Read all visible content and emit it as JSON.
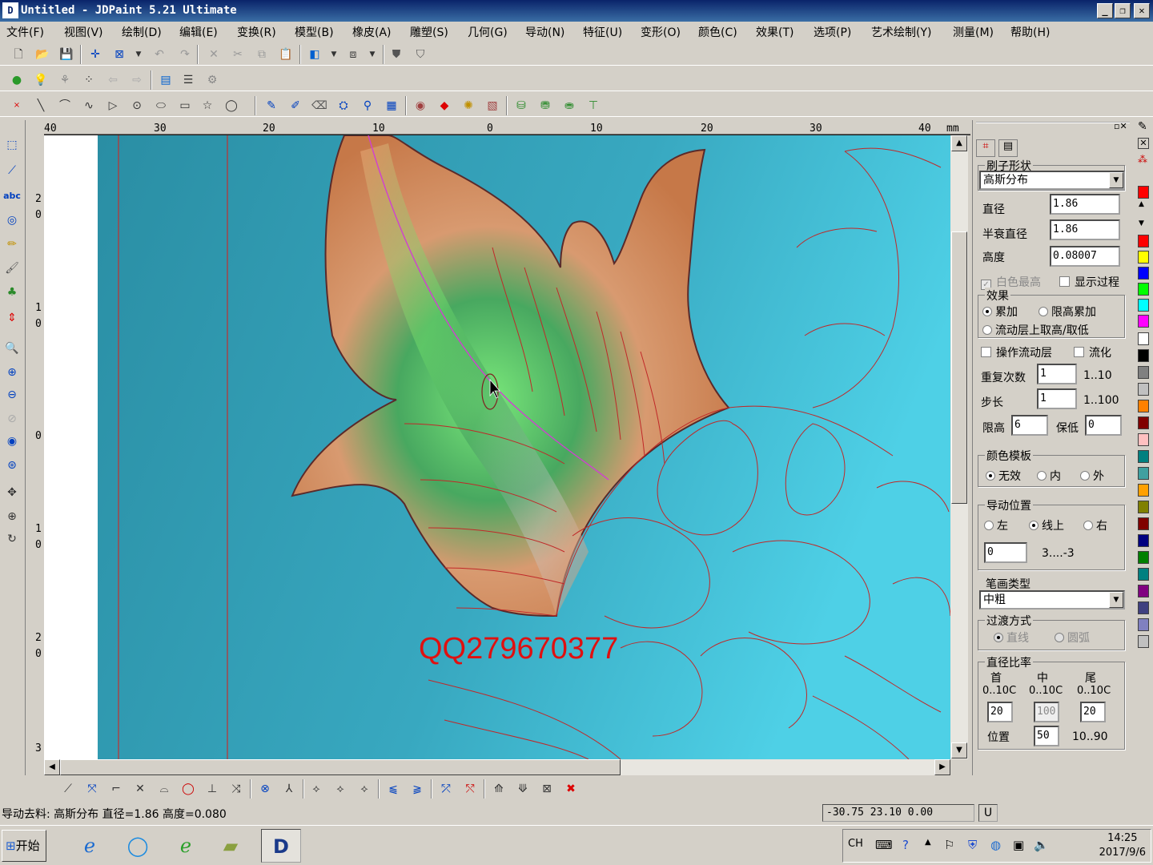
{
  "window": {
    "logo": "D",
    "title": "Untitled - JDPaint 5.21 Ultimate",
    "minimize": "_",
    "restore": "❐",
    "close": "✕"
  },
  "menu": [
    "文件(F)",
    "视图(V)",
    "绘制(D)",
    "编辑(E)",
    "变换(R)",
    "模型(B)",
    "橡皮(A)",
    "雕塑(S)",
    "几何(G)",
    "导动(N)",
    "特征(U)",
    "变形(O)",
    "颜色(C)",
    "效果(T)",
    "选项(P)",
    "艺术绘制(Y)",
    "测量(M)",
    "帮助(H)"
  ],
  "ruler_top": [
    "40",
    "30",
    "20",
    "10",
    "0",
    "10",
    "20",
    "30",
    "40",
    "mm"
  ],
  "ruler_left": [
    "2",
    "0",
    "1",
    "0",
    "0",
    "1",
    "0",
    "2",
    "0",
    "3",
    "0"
  ],
  "canvas": {
    "watermark": "QQ279670377",
    "bg_color": "#3aaec4",
    "relief_color": "#d98a5a"
  },
  "panel": {
    "brush_shape_title": "刷子形状",
    "brush_shape_value": "高斯分布",
    "diameter_label": "直径",
    "diameter_value": "1.86",
    "half_diameter_label": "半衰直径",
    "half_diameter_value": "1.86",
    "height_label": "高度",
    "height_value": "0.08007",
    "white_highest_label": "白色最高",
    "show_process_label": "显示过程",
    "effect_title": "效果",
    "effect_accumulate": "累加",
    "effect_limit_accumulate": "限高累加",
    "effect_flow_layer": "流动层上取高/取低",
    "operate_flow_label": "操作流动层",
    "streamline_label": "流化",
    "repeat_label": "重复次数",
    "repeat_value": "1",
    "repeat_range": "1..10",
    "step_label": "步长",
    "step_value": "1",
    "step_range": "1..100",
    "limit_high_label": "限高",
    "limit_high_value": "6",
    "keep_low_label": "保低",
    "keep_low_value": "0",
    "color_template_title": "颜色模板",
    "ct_none": "无效",
    "ct_inner": "内",
    "ct_outer": "外",
    "guide_pos_title": "导动位置",
    "gp_left": "左",
    "gp_online": "线上",
    "gp_right": "右",
    "gp_value": "0",
    "gp_range": "3....-3",
    "stroke_type_title": "笔画类型",
    "stroke_type_value": "中粗",
    "transition_title": "过渡方式",
    "tr_line": "直线",
    "tr_arc": "圆弧",
    "ratio_title": "直径比率",
    "ratio_head": "首",
    "ratio_mid": "中",
    "ratio_tail": "尾",
    "ratio_range": "0..10C",
    "ratio_head_value": "20",
    "ratio_mid_value": "100",
    "ratio_tail_value": "20",
    "position_label": "位置",
    "position_value": "50",
    "position_range": "10..90"
  },
  "palette": [
    "#ff0000",
    "#ff0000",
    "#ffff00",
    "#0000ff",
    "#00ff00",
    "#00ffff",
    "#ff00ff",
    "#ffffff",
    "#000000",
    "#808080",
    "#c0c0c0",
    "#ff8000",
    "#800000",
    "#ffc0c0",
    "#008080",
    "#40a0a0",
    "#ffa000",
    "#808000",
    "#800000",
    "#000080",
    "#008000",
    "#008080",
    "#800080",
    "#404080",
    "#8080c0",
    "#c0c0c0"
  ],
  "status": {
    "left": "导动去料: 高斯分布  直径=1.86  高度=0.080",
    "coords": "-30.75 23.10 0.00",
    "mode": "U"
  },
  "taskbar": {
    "start": "开始",
    "lang": "CH",
    "time": "14:25",
    "date": "2017/9/6"
  }
}
